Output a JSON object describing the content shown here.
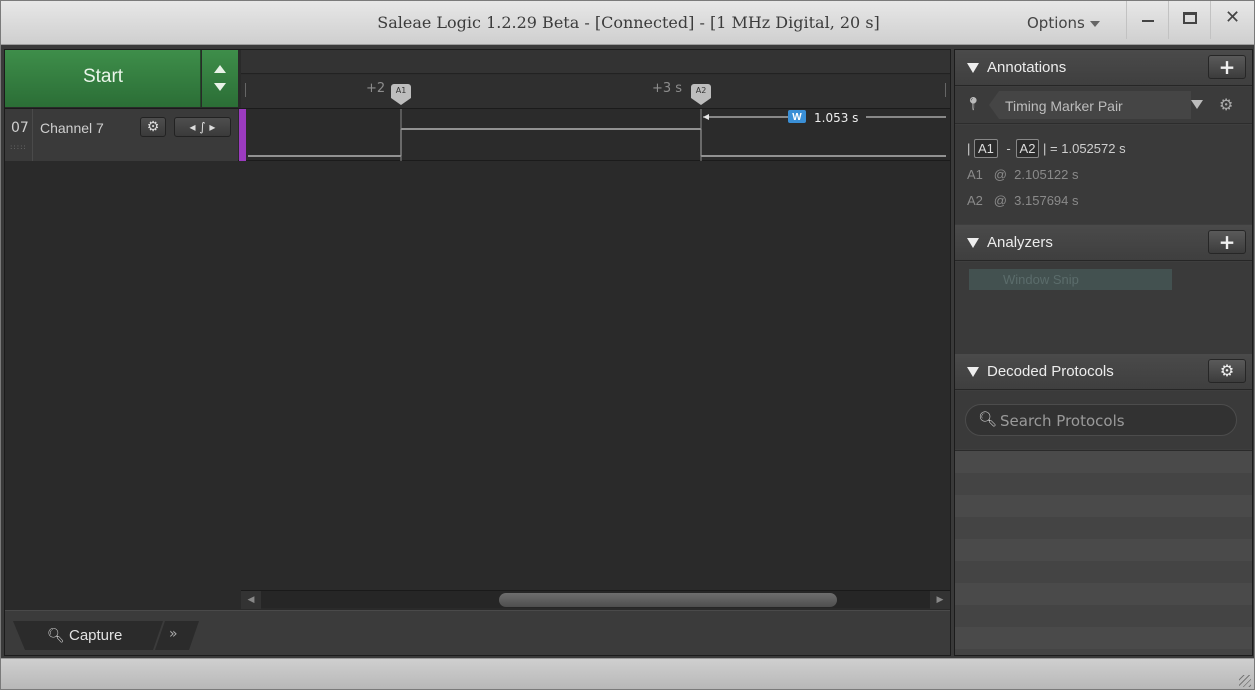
{
  "window": {
    "title": "Saleae Logic 1.2.29 Beta - [Connected] - [1 MHz Digital, 20 s]",
    "options_label": "Options"
  },
  "toolbar": {
    "start_label": "Start"
  },
  "timeline": {
    "ticks": [
      "+2",
      "+3 s"
    ],
    "markers": [
      {
        "label": "A1"
      },
      {
        "label": "A2"
      }
    ],
    "measure_badge": "W",
    "measure_value": "1.053 s"
  },
  "channel": {
    "number": "07",
    "name": "Channel 7",
    "color": "#9b3bbf"
  },
  "bottom_tabs": {
    "capture_label": "Capture"
  },
  "annotations": {
    "title": "Annotations",
    "pair_label": "Timing Marker Pair",
    "delta": {
      "a": "A1",
      "b": "A2",
      "value": "1.052572 s"
    },
    "marks": [
      {
        "name": "A1",
        "at": "2.105122 s"
      },
      {
        "name": "A2",
        "at": "3.157694 s"
      }
    ]
  },
  "analyzers": {
    "title": "Analyzers",
    "item": "Window Snip"
  },
  "decoded": {
    "title": "Decoded Protocols",
    "search_placeholder": "Search Protocols"
  }
}
